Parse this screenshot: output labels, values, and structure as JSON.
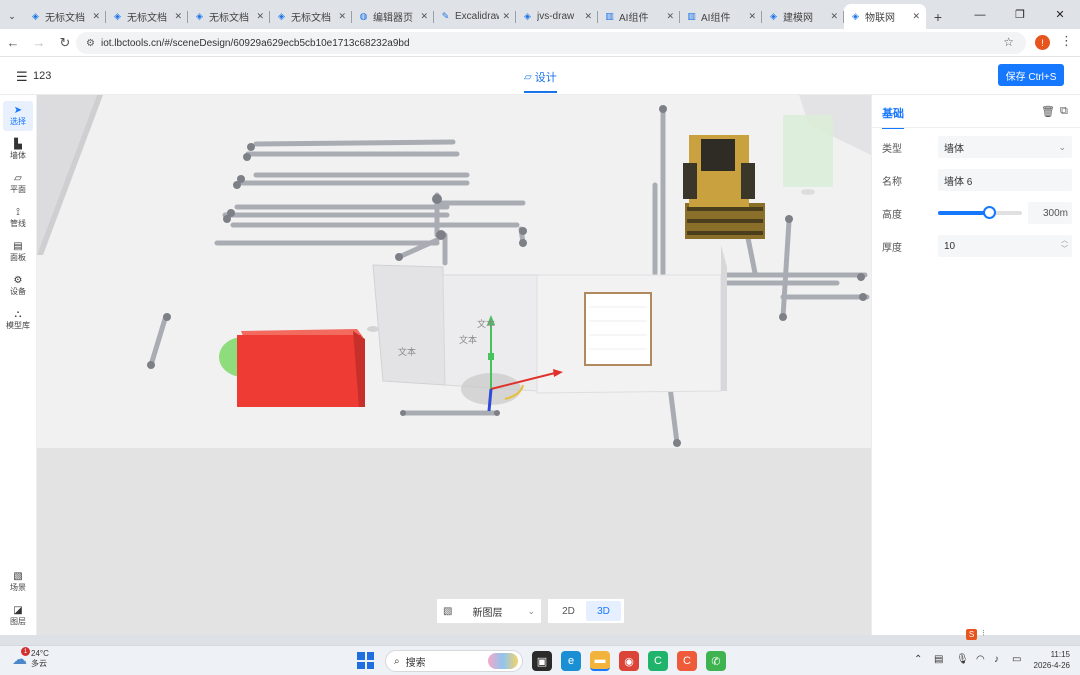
{
  "browser": {
    "tabs": [
      {
        "label": "无标文档",
        "icon": "app-icon"
      },
      {
        "label": "无标文档",
        "icon": "app-icon"
      },
      {
        "label": "无标文档",
        "icon": "app-icon"
      },
      {
        "label": "无标文档",
        "icon": "app-icon"
      },
      {
        "label": "编辑器页",
        "icon": "globe-icon"
      },
      {
        "label": "Excalidraw",
        "icon": "excalidraw-icon"
      },
      {
        "label": "jvs-draw",
        "icon": "app-icon"
      },
      {
        "label": "AI组件",
        "icon": "ai-icon"
      },
      {
        "label": "AI组件",
        "icon": "ai-icon"
      },
      {
        "label": "建模网",
        "icon": "app-icon"
      },
      {
        "label": "物联网",
        "icon": "app-icon"
      }
    ],
    "active_tab_index": 10,
    "url": "iot.lbctools.cn/#/sceneDesign/60929a629ecb5cb10e1713c68232a9bd"
  },
  "app": {
    "project_name": "123",
    "mode_tab": "设计",
    "save_button": "保存 Ctrl+S"
  },
  "left_tools": [
    {
      "label": "选择",
      "icon": "cursor-icon",
      "active": true
    },
    {
      "label": "墙体",
      "icon": "wall-icon",
      "active": false
    },
    {
      "label": "平面",
      "icon": "plane-icon",
      "active": false
    },
    {
      "label": "管线",
      "icon": "pipe-icon",
      "active": false
    },
    {
      "label": "面板",
      "icon": "panel-icon",
      "active": false
    },
    {
      "label": "设备",
      "icon": "device-icon",
      "active": false
    },
    {
      "label": "模型库",
      "icon": "model-library-icon",
      "active": false
    }
  ],
  "left_bottom_tools": [
    {
      "label": "场景",
      "icon": "scene-icon"
    },
    {
      "label": "图层",
      "icon": "layer-icon"
    }
  ],
  "viewport": {
    "panel_labels": [
      "文本",
      "文本",
      "文本"
    ],
    "layer_select": "新图层",
    "view_modes": [
      "2D",
      "3D"
    ],
    "active_view": "3D"
  },
  "properties": {
    "tab": "基础",
    "fields": {
      "type_label": "类型",
      "type_value": "墙体",
      "name_label": "名称",
      "name_value": "墙体 6",
      "height_label": "高度",
      "height_value": "300m",
      "height_fraction": 0.61,
      "thickness_label": "厚度",
      "thickness_value": "10"
    }
  },
  "taskbar": {
    "weather_temp": "24°C",
    "weather_desc": "多云",
    "weather_badge": "1",
    "search_label": "搜索",
    "time": "11:15",
    "date": "2026-4-26"
  },
  "colors": {
    "accent": "#1677ff",
    "red_box": "#ee3b33",
    "green_cylinder": "#8fdc7c",
    "pipe": "#a9adb3"
  }
}
